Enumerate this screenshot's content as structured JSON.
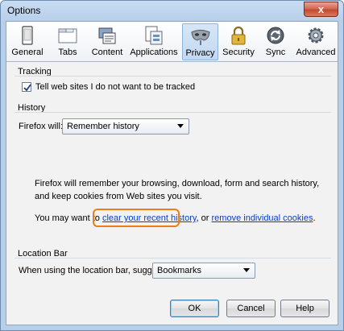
{
  "window": {
    "title": "Options",
    "close_glyph": "x"
  },
  "tabs": [
    {
      "label": "General",
      "icon": "general-icon"
    },
    {
      "label": "Tabs",
      "icon": "tabs-icon"
    },
    {
      "label": "Content",
      "icon": "content-icon"
    },
    {
      "label": "Applications",
      "icon": "applications-icon"
    },
    {
      "label": "Privacy",
      "icon": "privacy-mask-icon",
      "selected": true
    },
    {
      "label": "Security",
      "icon": "lock-icon"
    },
    {
      "label": "Sync",
      "icon": "sync-icon"
    },
    {
      "label": "Advanced",
      "icon": "gear-icon"
    }
  ],
  "tracking": {
    "heading": "Tracking",
    "dnt_checkbox_label": "Tell web sites I do not want to be tracked",
    "dnt_checked": true
  },
  "history": {
    "heading": "History",
    "firefox_will_label": "Firefox will:",
    "mode_value": "Remember history",
    "description": "Firefox will remember your browsing, download, form and search history, and keep cookies from Web sites you visit.",
    "clear_prefix": "You may want to ",
    "clear_link": "clear your recent history",
    "clear_middle": ", or ",
    "remove_link": "remove individual cookies",
    "clear_suffix": "."
  },
  "location_bar": {
    "heading": "Location Bar",
    "suggest_label": "When using the location bar, suggest:",
    "suggest_value": "Bookmarks"
  },
  "buttons": {
    "ok": "OK",
    "cancel": "Cancel",
    "help": "Help"
  },
  "colors": {
    "link": "#0a3ec9",
    "highlight": "#f07c16",
    "selected_tab": "#c2d8f1"
  }
}
